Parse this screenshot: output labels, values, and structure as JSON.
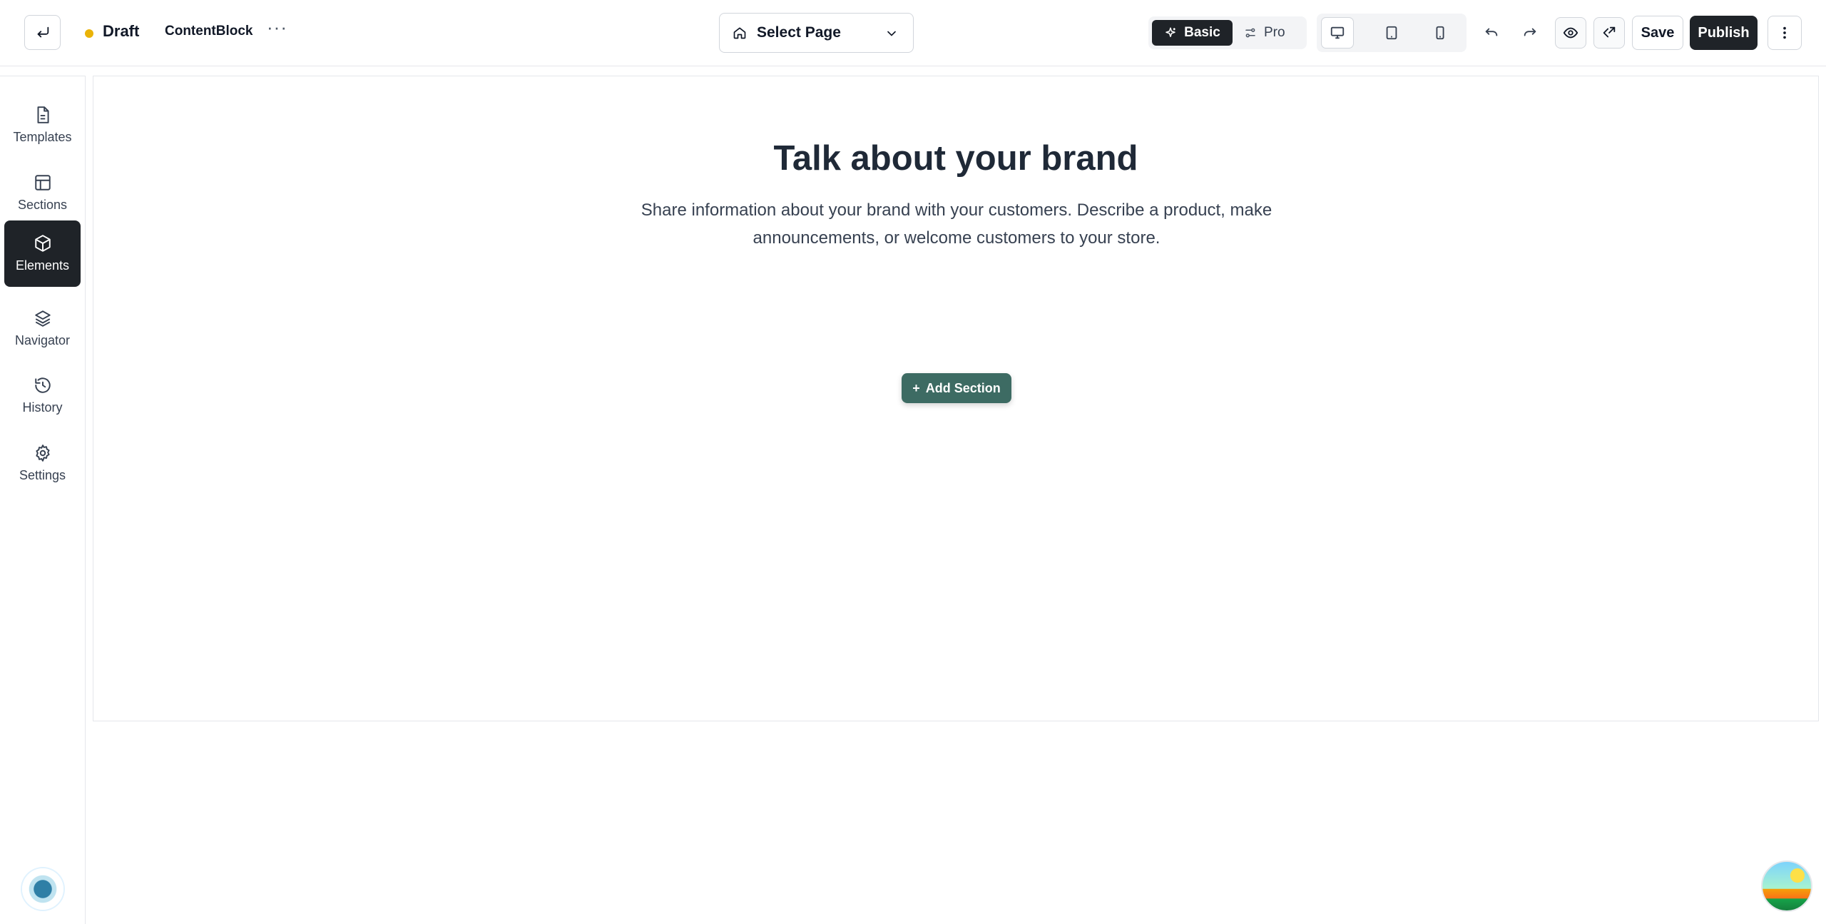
{
  "topbar": {
    "status": "Draft",
    "status_color": "#eab308",
    "doc_name": "ContentBlock",
    "more": "···",
    "page_select": "Select Page",
    "mode_basic": "Basic",
    "mode_pro": "Pro",
    "save": "Save",
    "publish": "Publish"
  },
  "sidebar": {
    "items": [
      {
        "label": "Templates",
        "icon": "file-icon"
      },
      {
        "label": "Sections",
        "icon": "layout-icon"
      },
      {
        "label": "Elements",
        "icon": "cube-icon",
        "active": true
      },
      {
        "label": "Navigator",
        "icon": "layers-icon"
      },
      {
        "label": "History",
        "icon": "history-icon"
      },
      {
        "label": "Settings",
        "icon": "gear-icon"
      }
    ]
  },
  "canvas": {
    "title": "Talk about your brand",
    "text": "Share information about your brand with your customers. Describe a product, make announcements, or welcome customers to your store.",
    "add_section": "Add Section",
    "add_section_color": "#3d6b63"
  },
  "colors": {
    "dark": "#1f2328",
    "border": "#e5e7eb"
  }
}
